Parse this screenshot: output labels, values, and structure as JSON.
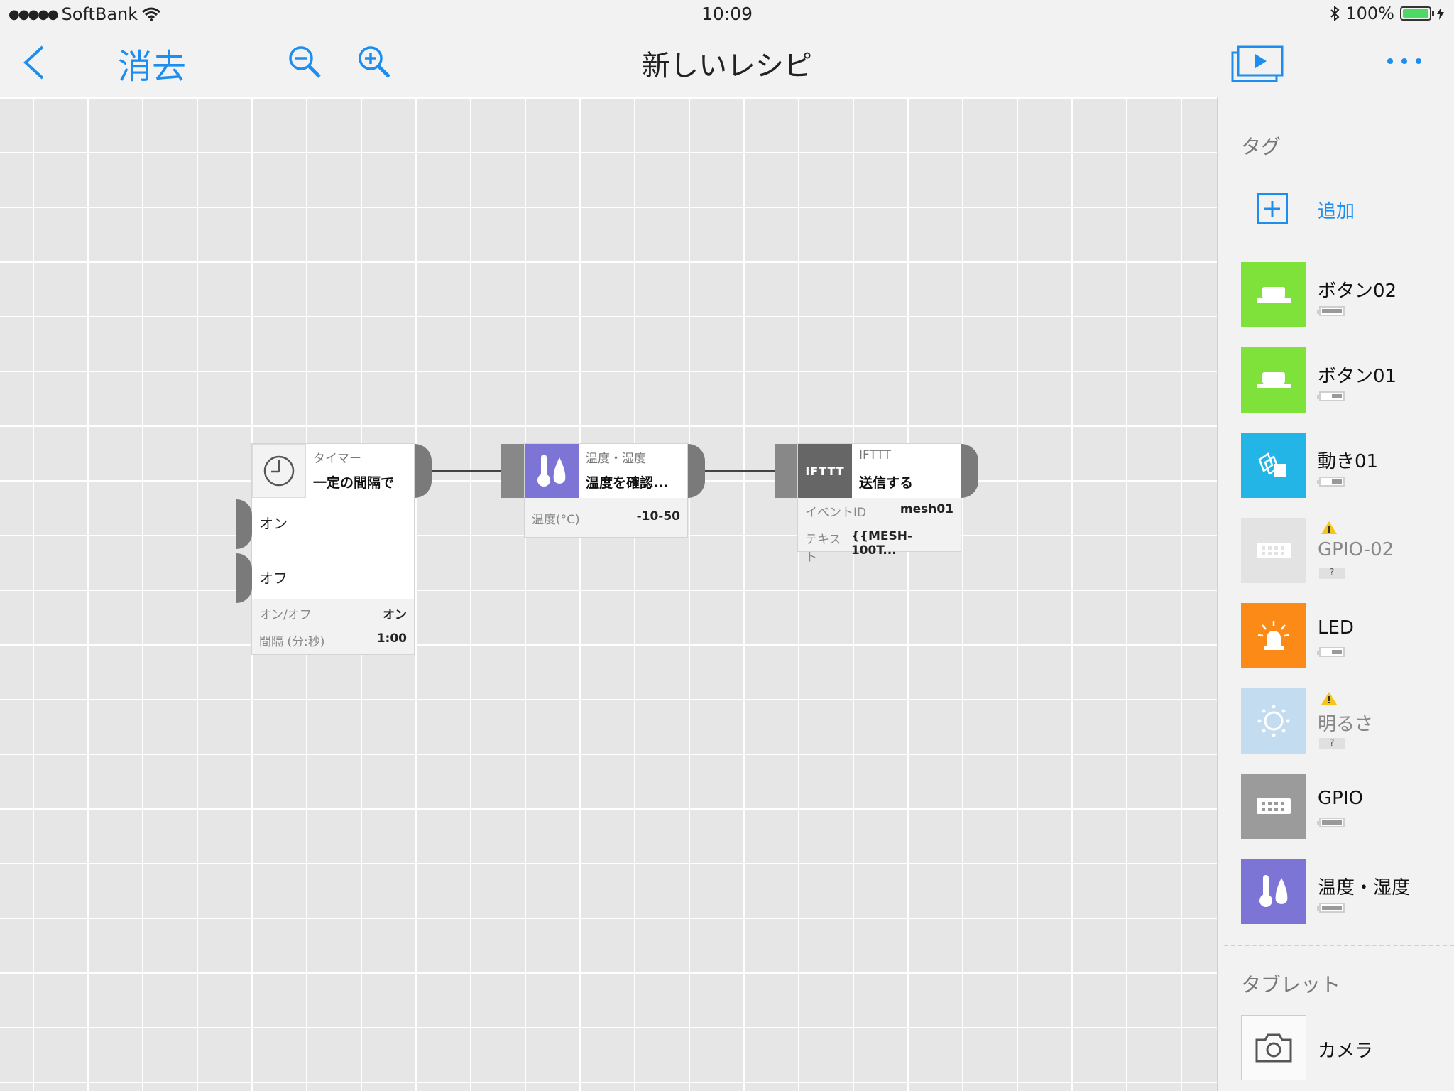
{
  "status": {
    "carrier": "SoftBank",
    "time": "10:09",
    "battery": "100%"
  },
  "nav": {
    "delete_label": "消去",
    "title": "新しいレシピ"
  },
  "blocks": {
    "timer": {
      "category": "タイマー",
      "name": "一定の間隔で",
      "trigger_on": "オン",
      "trigger_off": "オフ",
      "props": [
        {
          "label": "オン/オフ",
          "value": "オン"
        },
        {
          "label": "間隔 (分:秒)",
          "value": "1:00"
        }
      ]
    },
    "temp": {
      "category": "温度・湿度",
      "name": "温度を確認...",
      "props": [
        {
          "label": "温度(°C)",
          "value": "-10-50"
        }
      ]
    },
    "ifttt": {
      "category": "IFTTT",
      "icon_text": "IFTTT",
      "name": "送信する",
      "props": [
        {
          "label": "イベントID",
          "value": "mesh01"
        },
        {
          "label": "テキスト",
          "value": "{{MESH-100T..."
        }
      ]
    }
  },
  "sidebar": {
    "tags_header": "タグ",
    "add_label": "追加",
    "tags": [
      {
        "name": "ボタン02",
        "icon": "button-icon",
        "color": "#7ee23a",
        "battery": 0.85
      },
      {
        "name": "ボタン01",
        "icon": "button-icon",
        "color": "#7ee23a",
        "battery": 0.5
      },
      {
        "name": "動き01",
        "icon": "motion-icon",
        "color": "#22b5e6",
        "battery": 0.5
      },
      {
        "name": "GPIO-02",
        "icon": "gpio-icon",
        "color": "#e3e3e3",
        "status": "?",
        "warning": true
      },
      {
        "name": "LED",
        "icon": "led-icon",
        "color": "#fb8a17",
        "battery": 0.5
      },
      {
        "name": "明るさ",
        "icon": "brightness-icon",
        "color": "#c4dcf0",
        "status": "?",
        "warning": true
      },
      {
        "name": "GPIO",
        "icon": "gpio-icon",
        "color": "#9b9b9b",
        "battery": 0.85
      },
      {
        "name": "温度・湿度",
        "icon": "temperature-icon",
        "color": "#7c75d6",
        "battery": 0.85
      }
    ],
    "tablet_header": "タブレット",
    "tablet_items": [
      {
        "name": "カメラ",
        "icon": "camera-icon"
      }
    ]
  },
  "colors": {
    "accent": "#1d8ef0",
    "temp_block": "#7c75d6",
    "ifttt_block": "#666666"
  }
}
